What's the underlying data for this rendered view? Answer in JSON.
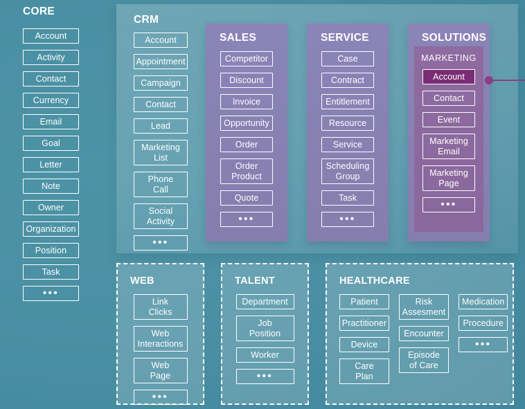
{
  "core": {
    "title": "CORE",
    "items": [
      "Account",
      "Activity",
      "Contact",
      "Currency",
      "Email",
      "Goal",
      "Letter",
      "Note",
      "Owner",
      "Organization",
      "Position",
      "Task",
      "•••"
    ]
  },
  "crm_panel": {
    "crm": {
      "title": "CRM",
      "items": [
        "Account",
        "Appointment",
        "Campaign",
        "Contact",
        "Lead",
        "Marketing List",
        "Phone Call",
        "Social Activity",
        "•••"
      ]
    },
    "sales": {
      "title": "SALES",
      "items": [
        "Competitor",
        "Discount",
        "Invoice",
        "Opportunity",
        "Order",
        "Order Product",
        "Quote",
        "•••"
      ]
    },
    "service": {
      "title": "SERVICE",
      "items": [
        "Case",
        "Contract",
        "Entitlement",
        "Resource",
        "Service",
        "Scheduling Group",
        "Task",
        "•••"
      ]
    },
    "solutions": {
      "title": "SOLUTIONS",
      "marketing": {
        "title": "MARKETING",
        "items": [
          "Account",
          "Contact",
          "Event",
          "Marketing Email",
          "Marketing Page",
          "•••"
        ],
        "selected": "Account"
      }
    }
  },
  "web": {
    "title": "WEB",
    "items": [
      "Link Clicks",
      "Web Interactions",
      "Web Page",
      "•••"
    ]
  },
  "talent": {
    "title": "TALENT",
    "items": [
      "Department",
      "Job Position",
      "Worker",
      "•••"
    ]
  },
  "healthcare": {
    "title": "HEALTHCARE",
    "column1": [
      "Patient",
      "Practitioner",
      "Device",
      "Care Plan"
    ],
    "column2": [
      "Risk Assesment",
      "Encounter",
      "Episode of Care"
    ],
    "column3": [
      "Medication",
      "Procedure",
      "•••"
    ]
  },
  "colors": {
    "background": "#4a8fa3",
    "panel_overlay": "#7ba7bd",
    "purple_panel": "#877fb0",
    "marketing_panel": "#8b689d",
    "selected_box": "#7a2d74",
    "connector": "#8e3d85",
    "text": "#ffffff"
  }
}
